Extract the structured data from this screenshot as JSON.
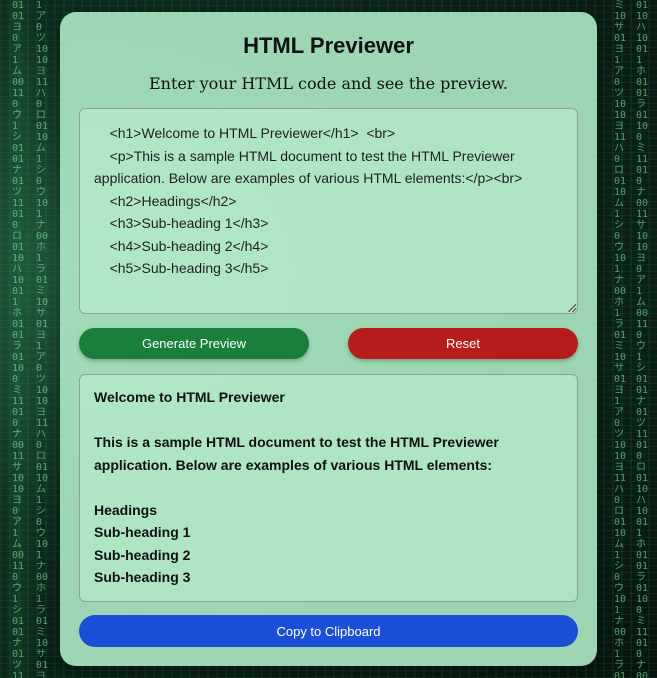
{
  "app": {
    "title": "HTML Previewer",
    "subtitle": "Enter your HTML code and see the preview."
  },
  "editor": {
    "value": "    <h1>Welcome to HTML Previewer</h1>  <br>\n    <p>This is a sample HTML document to test the HTML Previewer application. Below are examples of various HTML elements:</p><br>\n    <h2>Headings</h2>\n    <h3>Sub-heading 1</h3>\n    <h4>Sub-heading 2</h4>\n    <h5>Sub-heading 3</h5>"
  },
  "buttons": {
    "generate_label": "Generate Preview",
    "reset_label": "Reset",
    "copy_label": "Copy to Clipboard"
  },
  "preview": {
    "heading": "Welcome to HTML Previewer",
    "paragraph": "This is a sample HTML document to test the HTML Previewer application. Below are examples of various HTML elements:",
    "items": [
      "Headings",
      "Sub-heading 1",
      "Sub-heading 2",
      "Sub-heading 3"
    ]
  },
  "colors": {
    "generate": "#1a7f3c",
    "reset": "#b71c1c",
    "copy": "#1b4fd6",
    "card": "#b2eec8"
  }
}
